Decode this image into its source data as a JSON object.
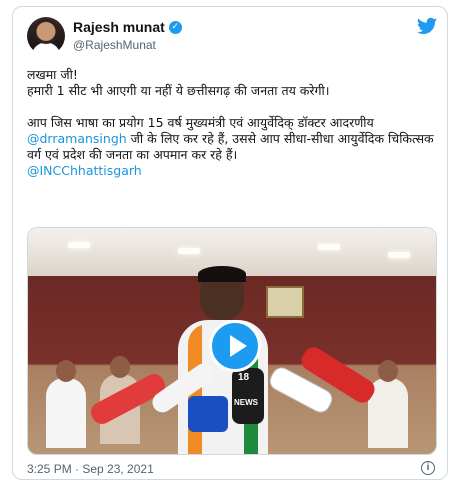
{
  "author": {
    "name": "Rajesh munat",
    "handle": "@RajeshMunat",
    "verified_icon": "verified-badge-icon"
  },
  "brand_icon": "twitter-bird-icon",
  "tweet": {
    "line1": "लखमा जी!",
    "line2": "हमारी 1 सीट भी आएगी या नहीं ये छत्तीसगढ़ की जनता तय करेगी।",
    "para2_before": "आप जिस भाषा का प्रयोग 15 वर्ष मुख्यमंत्री एवं आयुर्वेदिक् डॉक्टर आदरणीय ",
    "mention": "@drramansingh",
    "para2_after": " जी के लिए कर रहे हैं, उससे आप सीधा-सीधा आयुर्वेदिक चिकित्सक वर्ग एवं प्रदेश की जनता का अपमान कर रहे हैं।",
    "tag": "@INCChhattisgarh"
  },
  "media": {
    "play_icon": "play-button-icon",
    "mic_labels": [
      "18",
      "NEWS"
    ]
  },
  "timestamp": "3:25 PM · Sep 23, 2021",
  "info_icon": "info-icon",
  "colors": {
    "link": "#1b95e0",
    "accent": "#1d9bf0",
    "secondary_text": "#536471"
  }
}
